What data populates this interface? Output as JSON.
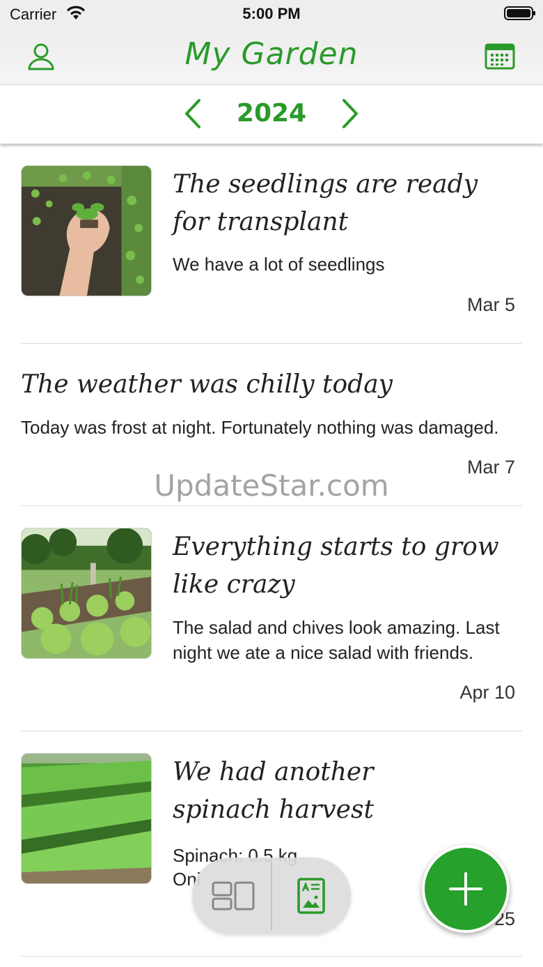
{
  "status_bar": {
    "carrier": "Carrier",
    "time": "5:00 PM"
  },
  "nav": {
    "title": "My Garden",
    "user_icon": "user-icon",
    "calendar_icon": "calendar-icon"
  },
  "year_selector": {
    "year": "2024",
    "prev_icon": "chevron-left-icon",
    "next_icon": "chevron-right-icon"
  },
  "entries": [
    {
      "title_line1": "The seedlings are ready",
      "title_line2": "for transplant",
      "body_line1": "We have a lot of seedlings",
      "date": "Mar 5",
      "image": "seedlings-in-hand-photo"
    },
    {
      "title_line1": "The weather was chilly today",
      "body_line1": "Today was frost at night. Fortunately nothing was damaged.",
      "date": "Mar 7"
    },
    {
      "title_line1": "Everything starts to grow",
      "title_line2": "like crazy",
      "body_line1": "The salad and chives look amazing. Last",
      "body_line2": "night we ate a nice salad with friends.",
      "date": "Apr 10",
      "image": "raised-garden-bed-photo"
    },
    {
      "title_line1": "We had another",
      "title_line2": "spinach harvest",
      "body_line1": "Spinach: 0.5 kg",
      "body_line2": "Oni",
      "date": "25",
      "image": "spinach-field-photo"
    }
  ],
  "watermark": "UpdateStar.com",
  "view_switch": {
    "grid_icon": "grid-view-icon",
    "list_icon": "list-view-icon"
  },
  "fab": {
    "icon": "plus-icon"
  },
  "colors": {
    "accent": "#2a9a2a",
    "fab": "#26a12c",
    "divider": "#dcdcdc"
  }
}
